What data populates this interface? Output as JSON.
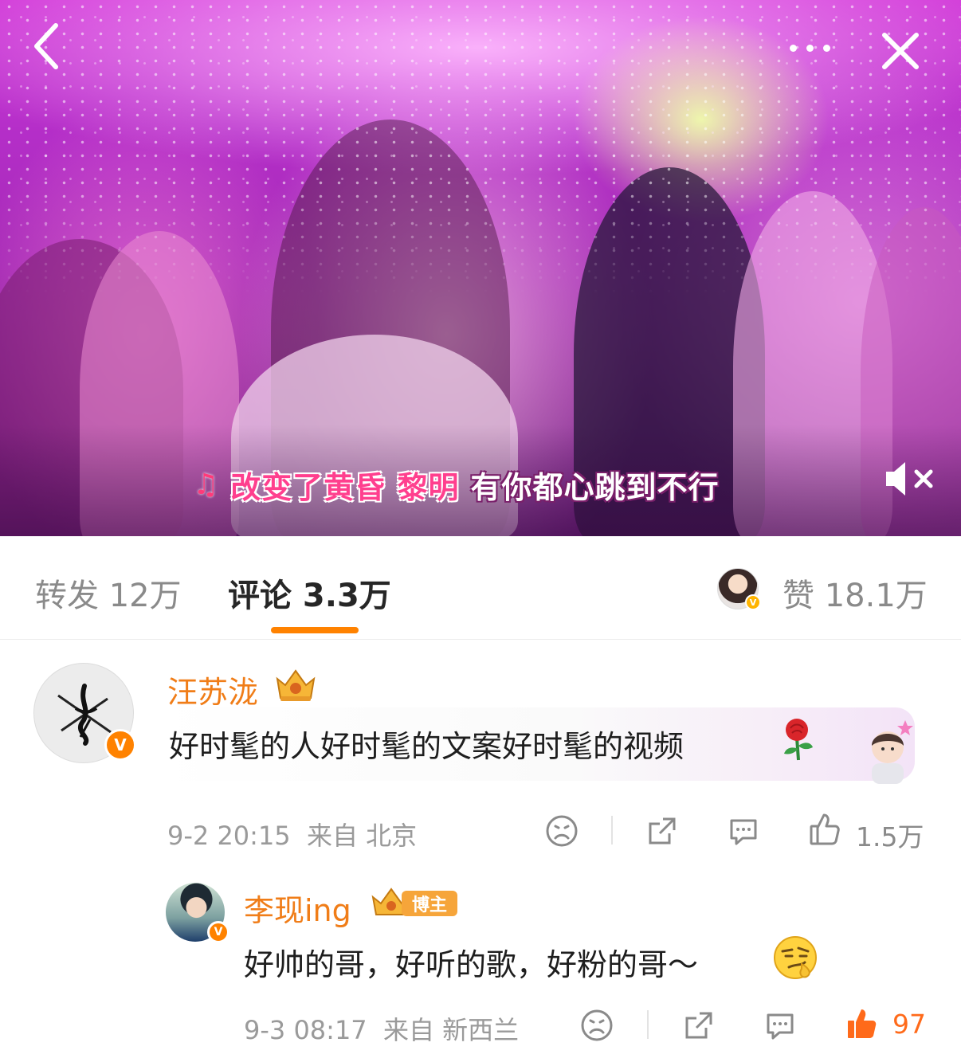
{
  "video": {
    "lyric": {
      "note": "♫",
      "sung": "改变了黄昏 黎明",
      "unsung": "有你都心跳到不行"
    },
    "icons": {
      "back": "chevron-left-icon",
      "more": "more-dots-icon",
      "close": "close-icon",
      "mute": "speaker-muted-icon"
    }
  },
  "tabs": {
    "repost": "转发 12万",
    "comment": "评论 3.3万",
    "like": "赞 18.1万",
    "accent": "#ff8200"
  },
  "comments": [
    {
      "user": "汪苏泷",
      "text": "好时髦的人好时髦的文案好时髦的视频",
      "time": "9-2 20:15",
      "location": "来自 北京",
      "likes": "1.5万",
      "liked": false,
      "verified_badge": "V"
    },
    {
      "user": "李现ing",
      "badge": "博主",
      "text": "好帅的哥，好听的歌，好粉的哥～",
      "time": "9-3 08:17",
      "location": "来自 新西兰",
      "likes": "97",
      "liked": true,
      "verified_badge": "V"
    }
  ],
  "colors": {
    "username": "#f07d18",
    "meta": "#9a9a9a",
    "liked": "#ff6a1a"
  }
}
